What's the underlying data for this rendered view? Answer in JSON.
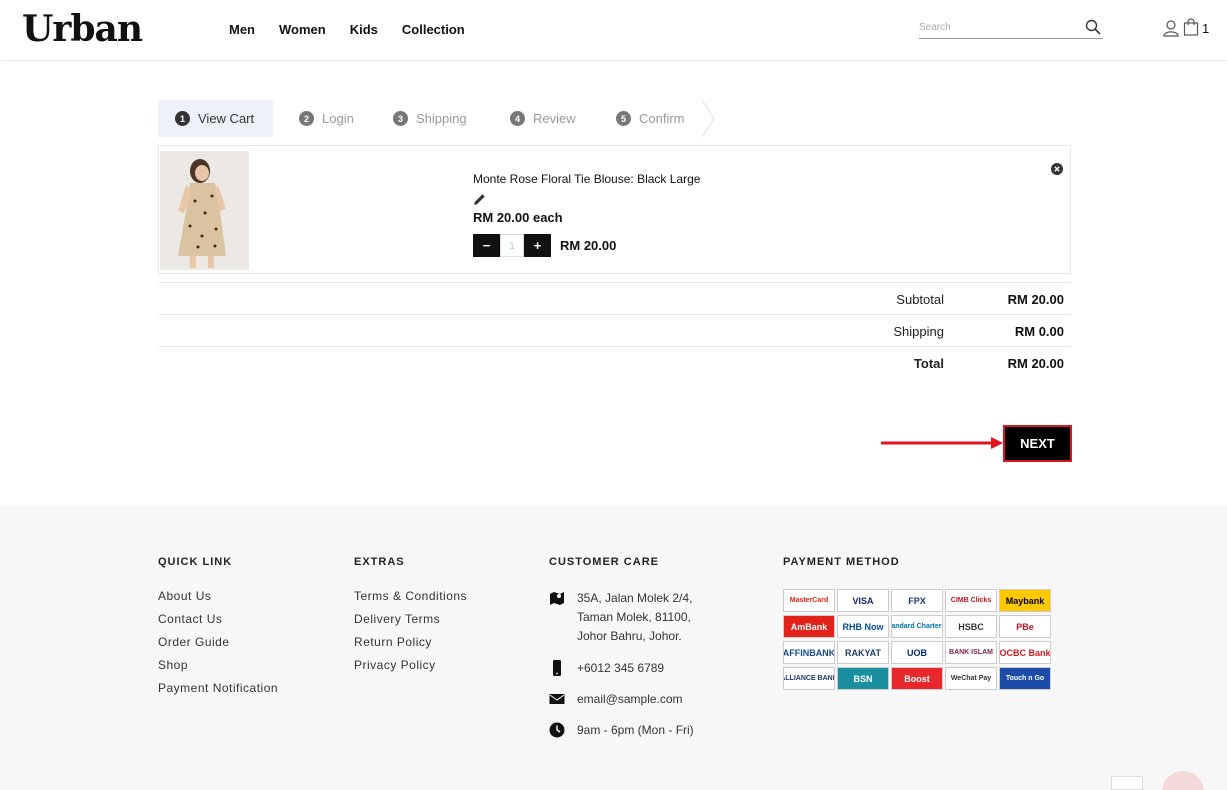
{
  "header": {
    "logo": "Urban",
    "nav": [
      "Men",
      "Women",
      "Kids",
      "Collection"
    ],
    "search_placeholder": "Search",
    "cart_count": "1"
  },
  "steps": [
    {
      "num": "1",
      "label": "View Cart",
      "active": true
    },
    {
      "num": "2",
      "label": "Login"
    },
    {
      "num": "3",
      "label": "Shipping"
    },
    {
      "num": "4",
      "label": "Review"
    },
    {
      "num": "5",
      "label": "Confirm"
    }
  ],
  "cart_item": {
    "title": "Monte Rose Floral Tie Blouse: Black Large",
    "price_each": "RM 20.00 each",
    "quantity": "1",
    "line_total": "RM 20.00"
  },
  "summary": {
    "subtotal_label": "Subtotal",
    "subtotal": "RM 20.00",
    "shipping_label": "Shipping",
    "shipping": "RM 0.00",
    "total_label": "Total",
    "total": "RM 20.00"
  },
  "next_label": "NEXT",
  "footer": {
    "quick_link": {
      "title": "QUICK LINK",
      "links": [
        "About Us",
        "Contact Us",
        "Order Guide",
        "Shop",
        "Payment Notification"
      ]
    },
    "extras": {
      "title": "EXTRAS",
      "links": [
        "Terms & Conditions",
        "Delivery Terms",
        "Return Policy",
        "Privacy Policy"
      ]
    },
    "care": {
      "title": "CUSTOMER CARE",
      "address": [
        "35A, Jalan Molek 2/4,",
        "Taman Molek, 81100,",
        "Johor Bahru, Johor."
      ],
      "phone": "+6012 345 6789",
      "email": "email@sample.com",
      "hours": "9am - 6pm (Mon - Fri)"
    },
    "payment": {
      "title": "PAYMENT METHOD",
      "methods": [
        {
          "name": "MasterCard",
          "color": "#e2231a",
          "bg": "#ffffff"
        },
        {
          "name": "VISA",
          "color": "#1a1f71",
          "bg": "#ffffff"
        },
        {
          "name": "FPX",
          "color": "#1a3a6e",
          "bg": "#ffffff"
        },
        {
          "name": "CIMB Clicks",
          "color": "#c4161c",
          "bg": "#ffffff"
        },
        {
          "name": "Maybank",
          "color": "#000000",
          "bg": "#ffc800"
        },
        {
          "name": "AmBank",
          "color": "#ffffff",
          "bg": "#e2231a"
        },
        {
          "name": "RHB Now",
          "color": "#004c97",
          "bg": "#ffffff"
        },
        {
          "name": "Standard Chartered",
          "color": "#0072aa",
          "bg": "#ffffff"
        },
        {
          "name": "HSBC",
          "color": "#333333",
          "bg": "#ffffff"
        },
        {
          "name": "PBe",
          "color": "#c4161c",
          "bg": "#ffffff"
        },
        {
          "name": "AFFINBANK",
          "color": "#1a4a8e",
          "bg": "#ffffff"
        },
        {
          "name": "RAKYAT",
          "color": "#1a3a6e",
          "bg": "#ffffff"
        },
        {
          "name": "UOB",
          "color": "#002d72",
          "bg": "#ffffff"
        },
        {
          "name": "BANK ISLAM",
          "color": "#7a1f4a",
          "bg": "#ffffff"
        },
        {
          "name": "OCBC Bank",
          "color": "#d71920",
          "bg": "#ffffff"
        },
        {
          "name": "ALLIANCE BANK",
          "color": "#1a3a6e",
          "bg": "#ffffff"
        },
        {
          "name": "BSN",
          "color": "#ffffff",
          "bg": "#1a8fa0"
        },
        {
          "name": "Boost",
          "color": "#ffffff",
          "bg": "#e8272c"
        },
        {
          "name": "WeChat Pay",
          "color": "#333333",
          "bg": "#ffffff"
        },
        {
          "name": "Touch n Go",
          "color": "#ffffff",
          "bg": "#1a4ca8"
        }
      ]
    }
  },
  "colors": {
    "accent": "#e0141e",
    "dark": "#111111",
    "footer_bg": "#f7f7f7"
  }
}
